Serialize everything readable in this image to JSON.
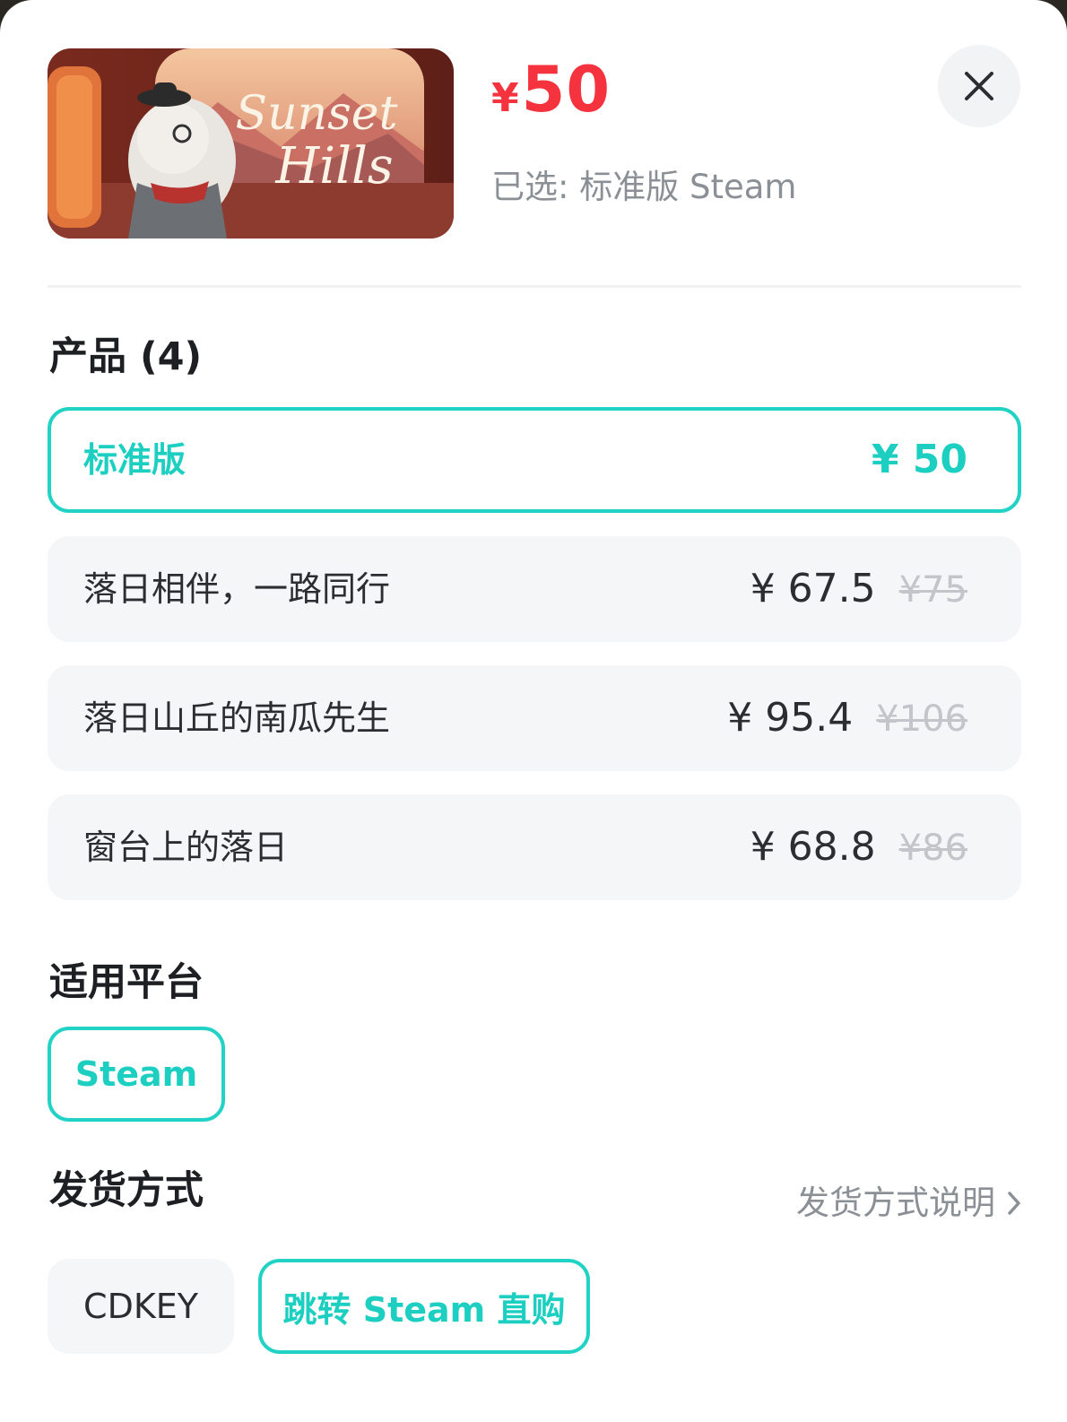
{
  "header": {
    "currency_symbol": "¥",
    "price": "50",
    "selected_text": "已选: 标准版 Steam"
  },
  "products": {
    "title": "产品 (4)",
    "items": [
      {
        "name": "标准版",
        "price": "¥ 50",
        "original_price": "",
        "selected": true
      },
      {
        "name": "落日相伴，一路同行",
        "price": "¥ 67.5",
        "original_price": "¥75",
        "selected": false
      },
      {
        "name": "落日山丘的南瓜先生",
        "price": "¥ 95.4",
        "original_price": "¥106",
        "selected": false
      },
      {
        "name": "窗台上的落日",
        "price": "¥ 68.8",
        "original_price": "¥86",
        "selected": false
      }
    ]
  },
  "platform": {
    "title": "适用平台",
    "options": [
      "Steam"
    ]
  },
  "shipping": {
    "title": "发货方式",
    "info_link": "发货方式说明",
    "options": [
      "CDKEY",
      "跳转 Steam 直购"
    ]
  },
  "colors": {
    "accent": "#22d3c5",
    "price_red": "#f5333f",
    "muted_text": "#8b9096",
    "row_bg": "#f5f6f8"
  },
  "icons": {
    "close": "close-icon",
    "chevron": "chevron-right-icon"
  }
}
